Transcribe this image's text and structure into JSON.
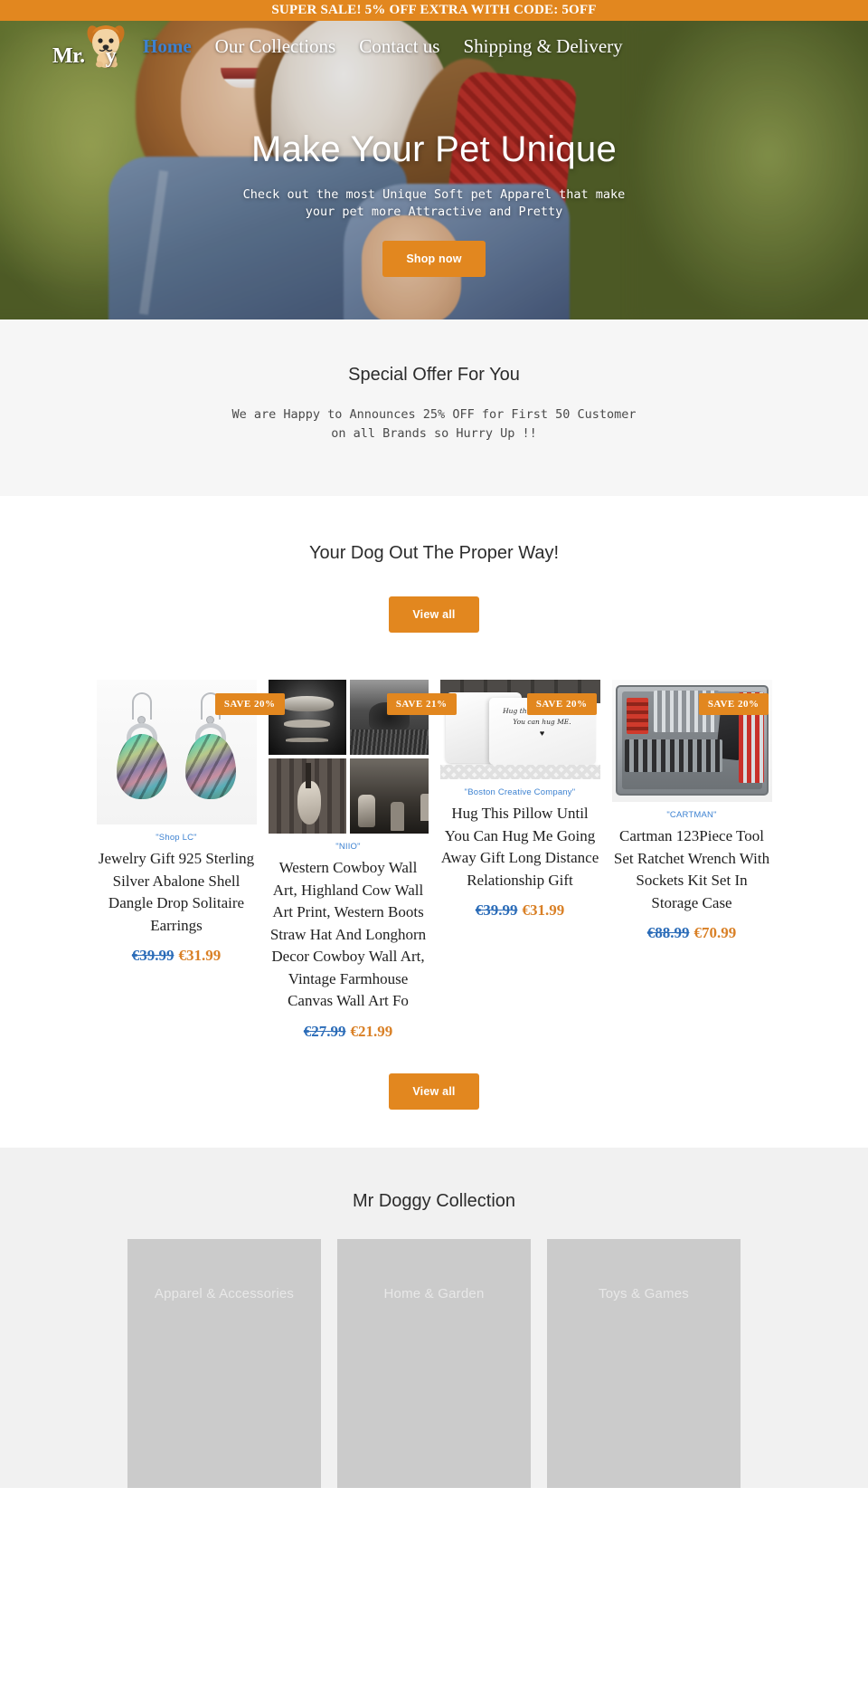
{
  "announcement": {
    "text": "SUPER SALE! 5% OFF EXTRA WITH CODE: 5OFF"
  },
  "brand": {
    "name": "Mr.",
    "suffix": "y",
    "logo_icon": "dog-logo-icon"
  },
  "nav": {
    "items": [
      {
        "label": "Home",
        "active": true
      },
      {
        "label": "Our Collections",
        "active": false
      },
      {
        "label": "Contact us",
        "active": false
      },
      {
        "label": "Shipping & Delivery",
        "active": false
      }
    ]
  },
  "hero": {
    "title": "Make Your Pet Unique",
    "subtitle": "Check out the most Unique Soft pet Apparel that make your pet more Attractive and Pretty",
    "cta": "Shop now"
  },
  "offer": {
    "title": "Special Offer For You",
    "body": "We are Happy to Announces 25% OFF for First 50 Customer on all Brands so Hurry Up !!"
  },
  "products_section": {
    "title": "Your Dog Out The Proper Way!",
    "view_all_top": "View all",
    "view_all_bottom": "View all",
    "items": [
      {
        "badge": "SAVE 20%",
        "vendor": "\"Shop LC\"",
        "title": "Jewelry Gift 925 Sterling Silver Abalone Shell Dangle Drop Solitaire Earrings",
        "price_old": "€39.99",
        "price_new": "€31.99",
        "image": "abalone-earrings-image"
      },
      {
        "badge": "SAVE 21%",
        "vendor": "\"NIIO\"",
        "title": "Western Cowboy Wall Art, Highland Cow Wall Art Print, Western Boots Straw Hat And Longhorn Decor Cowboy Wall Art, Vintage Farmhouse Canvas Wall Art Fo",
        "price_old": "€27.99",
        "price_new": "€21.99",
        "image": "western-wall-art-image"
      },
      {
        "badge": "SAVE 20%",
        "vendor": "\"Boston Creative Company\"",
        "title": "Hug This Pillow Until You Can Hug Me Going Away Gift Long Distance Relationship Gift",
        "price_old": "€39.99",
        "price_new": "€31.99",
        "image": "hug-pillow-image",
        "pillow_text_line1": "Hug this PILLOW until",
        "pillow_text_line2": "You can hug ME.",
        "pillow_heart": "♥"
      },
      {
        "badge": "SAVE 20%",
        "vendor": "\"CARTMAN\"",
        "title": "Cartman 123Piece Tool Set Ratchet Wrench With Sockets Kit Set In Storage Case",
        "price_old": "€88.99",
        "price_new": "€70.99",
        "image": "tool-set-image"
      }
    ]
  },
  "collection": {
    "title": "Mr Doggy Collection",
    "cards": [
      {
        "label": "Apparel & Accessories"
      },
      {
        "label": "Home & Garden"
      },
      {
        "label": "Toys & Games"
      }
    ]
  },
  "colors": {
    "accent": "#e2871f",
    "link_blue": "#3d82d1",
    "price_old": "#2b6cb8",
    "price_new": "#d98026",
    "offer_bg": "#f6f6f6",
    "collection_bg": "#f1f1f1"
  }
}
